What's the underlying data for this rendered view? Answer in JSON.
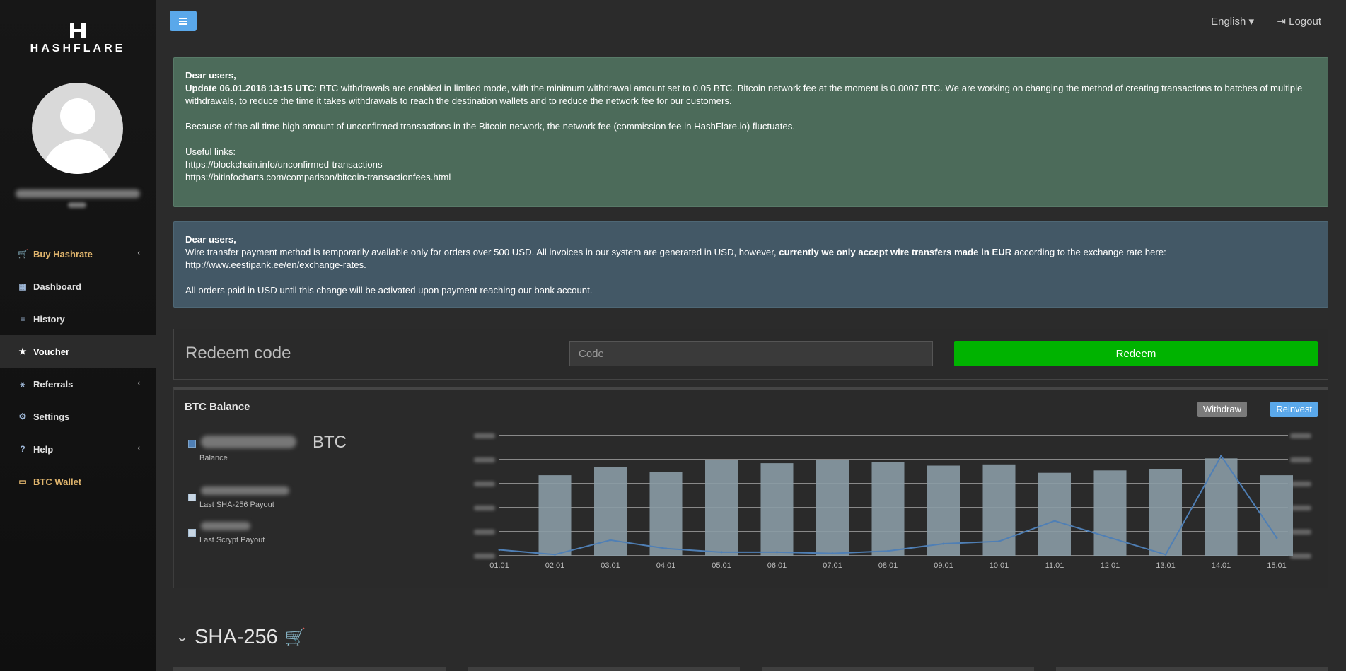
{
  "brand": {
    "name": "HASHFLARE"
  },
  "sidebar": {
    "items": [
      {
        "label": "Buy Hashrate",
        "icon": "cart-icon",
        "glyph": "🛒",
        "expand": "‹"
      },
      {
        "label": "Dashboard",
        "icon": "dashboard-icon",
        "glyph": "▦"
      },
      {
        "label": "History",
        "icon": "list-icon",
        "glyph": "≡"
      },
      {
        "label": "Voucher",
        "icon": "star-icon",
        "glyph": "★"
      },
      {
        "label": "Referrals",
        "icon": "network-icon",
        "glyph": "⚹",
        "expand": "‹"
      },
      {
        "label": "Settings",
        "icon": "gears-icon",
        "glyph": "⚙"
      },
      {
        "label": "Help",
        "icon": "question-icon",
        "glyph": "?",
        "expand": "‹"
      },
      {
        "label": "BTC Wallet",
        "icon": "wallet-icon",
        "glyph": "▭"
      }
    ]
  },
  "topbar": {
    "language": "English ▾",
    "logout": "Logout",
    "logout_glyph": "⇥"
  },
  "alerts": [
    {
      "heading": "Dear users,",
      "update_bold": "Update 06.01.2018 13:15 UTC",
      "update_text": ": BTC withdrawals are enabled in limited mode, with the minimum withdrawal amount set to 0.05 BTC. Bitcoin network fee at the moment is 0.0007 BTC. We are working on changing the method of creating transactions to batches of multiple withdrawals, to reduce the time it takes withdrawals to reach the destination wallets and to reduce the network fee for our customers.",
      "para2": "Because of the all time high amount of unconfirmed transactions in the Bitcoin network, the network fee (commission fee in HashFlare.io) fluctuates.",
      "links_label": "Useful links:",
      "link1": "https://blockchain.info/unconfirmed-transactions",
      "link2": "https://bitinfocharts.com/comparison/bitcoin-transactionfees.html"
    },
    {
      "heading": "Dear users,",
      "text1": "Wire transfer payment method is temporarily available only for orders over 500 USD. All invoices in our system are generated in USD, however, ",
      "bold": "currently we only accept wire transfers made in EUR",
      "text2": " according to the exchange rate here:",
      "link": "http://www.eestipank.ee/en/exchange-rates.",
      "para2": "All orders paid in USD until this change will be activated upon payment reaching our bank account."
    }
  ],
  "redeem": {
    "title": "Redeem code",
    "placeholder": "Code",
    "button": "Redeem"
  },
  "btc_panel": {
    "title": "BTC Balance",
    "withdraw": "Withdraw",
    "reinvest": "Reinvest",
    "legend": [
      {
        "unit": "BTC",
        "label": "Balance"
      },
      {
        "label": "Last SHA-256 Payout"
      },
      {
        "label": "Last Scrypt Payout"
      }
    ]
  },
  "chart_data": {
    "type": "bar",
    "categories": [
      "01.01",
      "02.01",
      "03.01",
      "04.01",
      "05.01",
      "06.01",
      "07.01",
      "08.01",
      "09.01",
      "10.01",
      "11.01",
      "12.01",
      "13.01",
      "14.01",
      "15.01"
    ],
    "series": [
      {
        "type": "bar",
        "values": [
          0,
          0.67,
          0.74,
          0.7,
          0.8,
          0.77,
          0.8,
          0.78,
          0.75,
          0.76,
          0.69,
          0.71,
          0.72,
          0.81,
          0.67
        ]
      },
      {
        "type": "line",
        "values": [
          0.05,
          0.01,
          0.13,
          0.06,
          0.03,
          0.03,
          0.02,
          0.04,
          0.1,
          0.12,
          0.29,
          0.15,
          0.01,
          0.83,
          0.15
        ]
      }
    ],
    "ylim": [
      0,
      1
    ],
    "grid": true,
    "colors": {
      "bar": "#8a9ba5",
      "line": "#4f7fb5"
    }
  },
  "sha_section": {
    "title": "SHA-256",
    "expand_glyph": "⌄",
    "cart_glyph": "🛒"
  }
}
